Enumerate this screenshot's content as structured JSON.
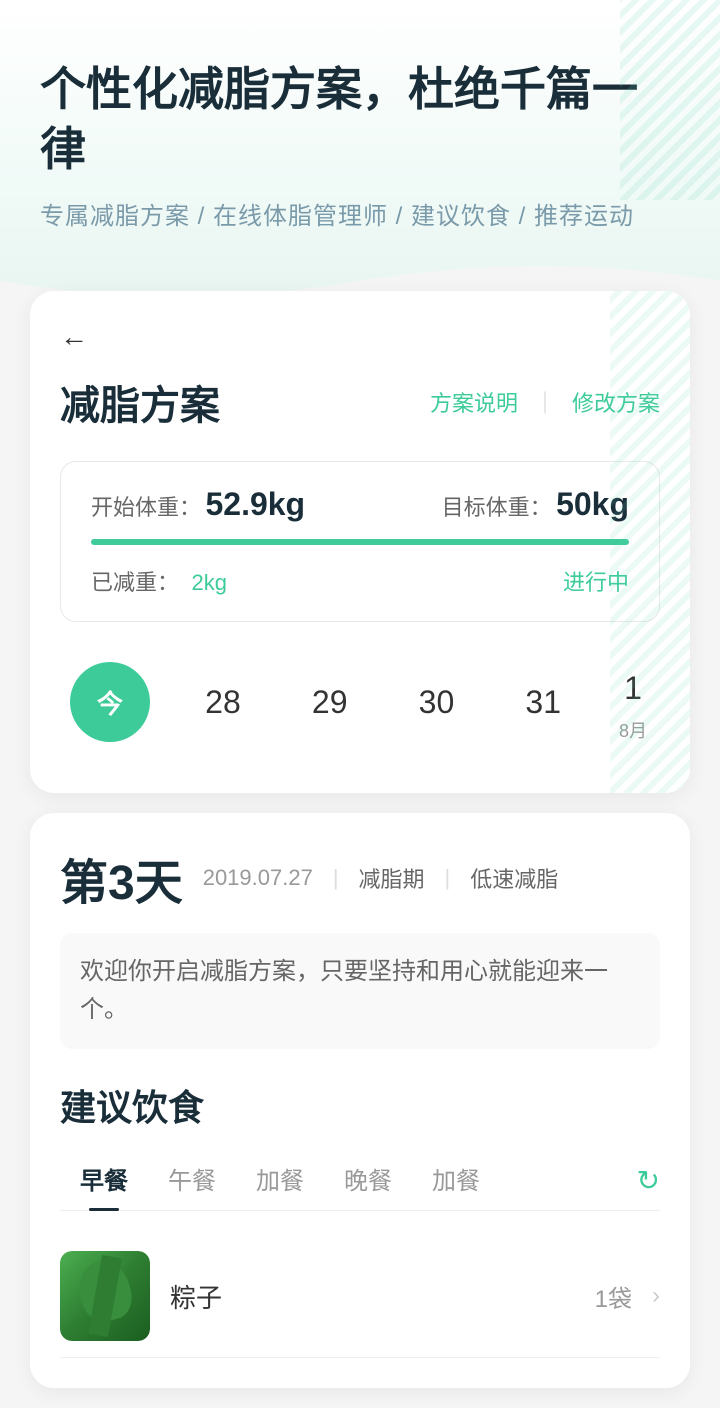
{
  "header": {
    "title": "个性化减脂方案，杜绝千篇一律",
    "subtitle": "专属减脂方案 / 在线体脂管理师 / 建议饮食 / 推荐运动"
  },
  "card": {
    "back_label": "←",
    "title": "减脂方案",
    "action_explain": "方案说明",
    "action_divider": "｜",
    "action_modify": "修改方案",
    "weight": {
      "start_label": "开始体重：",
      "start_value": "52.9kg",
      "target_label": "目标体重：",
      "target_value": "50kg",
      "lost_label": "已减重：",
      "lost_value": "2kg",
      "status": "进行中"
    },
    "dates": [
      {
        "num": "今",
        "active": true
      },
      {
        "num": "28",
        "active": false
      },
      {
        "num": "29",
        "active": false
      },
      {
        "num": "30",
        "active": false
      },
      {
        "num": "31",
        "active": false
      },
      {
        "num": "1",
        "month": "8月",
        "active": false
      }
    ]
  },
  "day": {
    "label": "第3天",
    "date": "2019.07.27",
    "tag1": "减脂期",
    "tag2": "低速减脂",
    "description": "欢迎你开启减脂方案，只要坚持和用心就能迎来一个。"
  },
  "diet": {
    "title": "建议饮食",
    "tabs": [
      {
        "label": "早餐",
        "active": true
      },
      {
        "label": "午餐",
        "active": false
      },
      {
        "label": "加餐",
        "active": false
      },
      {
        "label": "晚餐",
        "active": false
      },
      {
        "label": "加餐",
        "active": false
      }
    ],
    "refresh_icon": "↻",
    "food_items": [
      {
        "name": "粽子",
        "qty": "1袋",
        "has_arrow": true
      }
    ]
  }
}
